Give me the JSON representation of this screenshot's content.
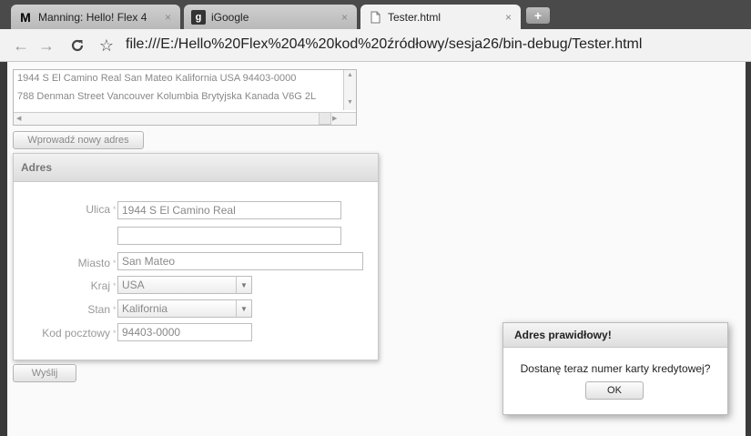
{
  "browser": {
    "tabs": [
      {
        "title": "Manning: Hello! Flex 4",
        "icon": "M",
        "active": false
      },
      {
        "title": "iGoogle",
        "icon": "g",
        "active": false
      },
      {
        "title": "Tester.html",
        "icon": "page",
        "active": true
      }
    ],
    "close_glyph": "×",
    "new_tab_glyph": "+",
    "url": "file:///E:/Hello%20Flex%204%20kod%20źródłowy/sesja26/bin-debug/Tester.html"
  },
  "address_list": {
    "rows": [
      "1944 S El Camino Real San Mateo Kalifornia USA 94403-0000",
      "788 Denman Street Vancouver Kolumbia Brytyjska Kanada V6G 2L"
    ]
  },
  "new_address_button": "Wprowadź nowy adres",
  "form": {
    "title": "Adres",
    "required_marker": "*",
    "street_label": "Ulica",
    "street_line1": "1944 S El Camino Real",
    "street_line2": "",
    "city_label": "Miasto",
    "city_value": "San Mateo",
    "country_label": "Kraj",
    "country_value": "USA",
    "state_label": "Stan",
    "state_value": "Kalifornia",
    "postal_label": "Kod pocztowy",
    "postal_value": "94403-0000"
  },
  "submit_button": "Wyślij",
  "alert": {
    "title": "Adres prawidłowy!",
    "message": "Dostanę teraz numer karty kredytowej?",
    "ok_label": "OK"
  }
}
